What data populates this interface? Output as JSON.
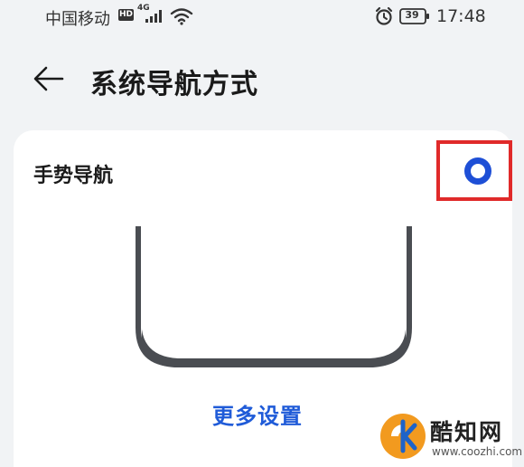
{
  "status_bar": {
    "carrier": "中国移动",
    "hd_badge": "HD",
    "network_type": "4G",
    "battery_level": "39",
    "time": "17:48"
  },
  "header": {
    "back_icon": "back-arrow-icon",
    "title": "系统导航方式"
  },
  "card": {
    "option_label": "手势导航",
    "option_selected": true,
    "radio_color": "#1e4fd6",
    "highlight_color": "#e02a2a",
    "more_settings_label": "更多设置",
    "link_color": "#1f5bd8"
  },
  "watermark": {
    "name": "酷知网",
    "url": "www.coozhi.com"
  }
}
